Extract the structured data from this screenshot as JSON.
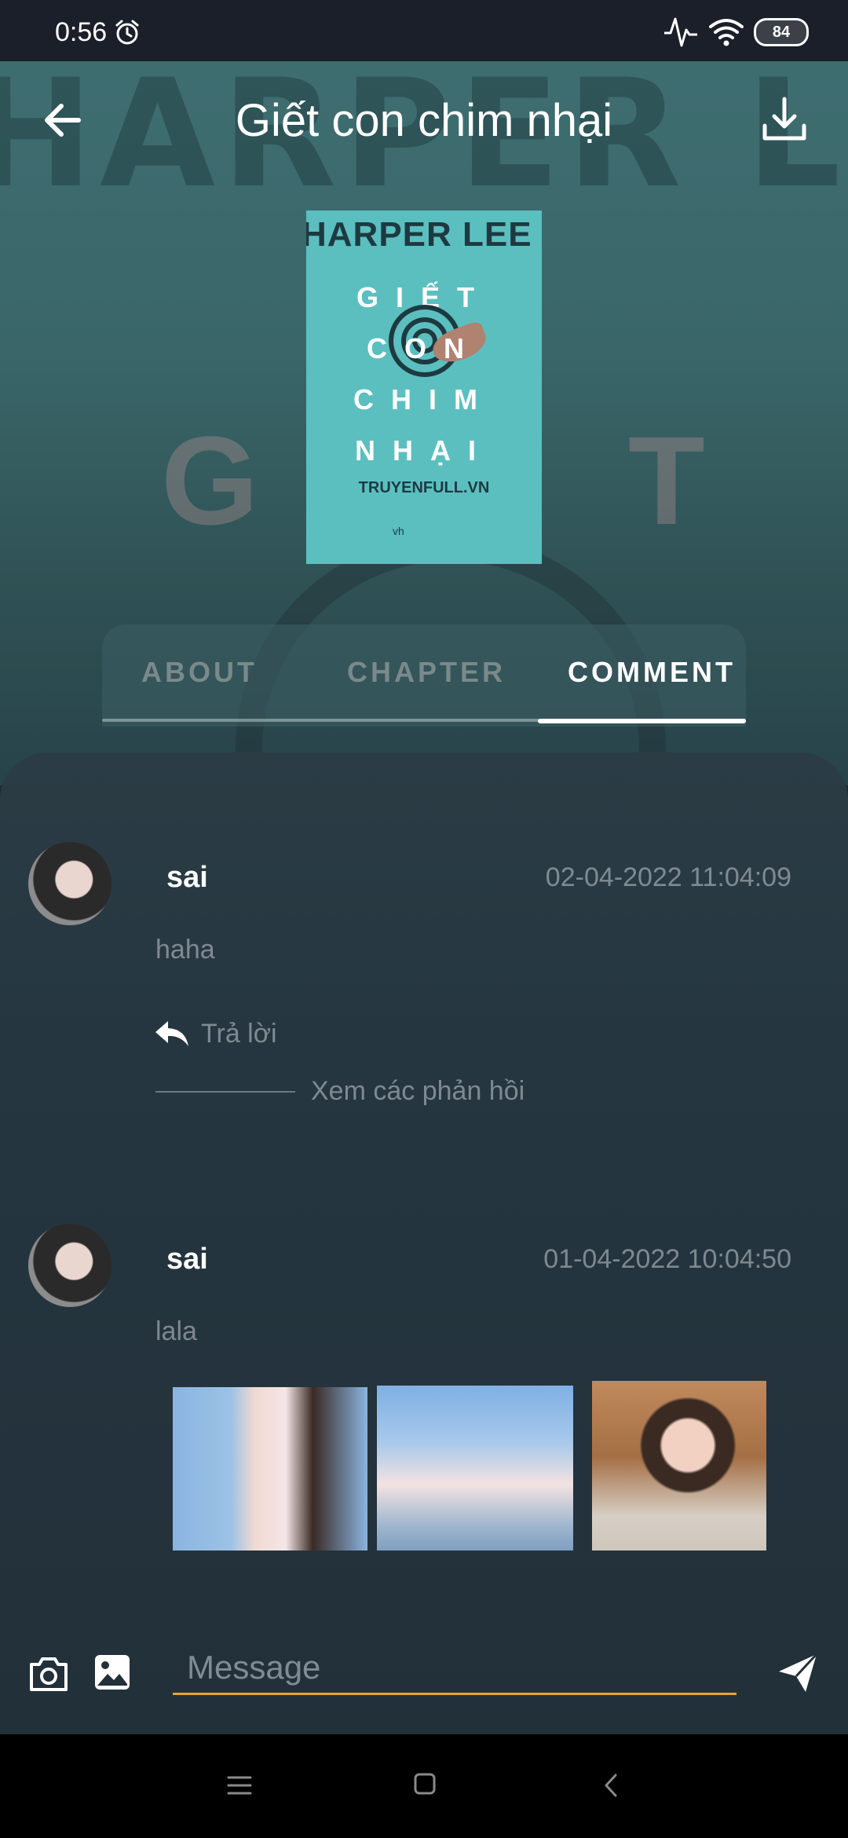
{
  "status_bar": {
    "time": "0:56",
    "battery": "84",
    "icons": [
      "alarm-icon",
      "activity-icon",
      "wifi-icon",
      "battery-icon"
    ]
  },
  "app_bar": {
    "title": "Giết con chim nhại",
    "back_icon": "arrow-left-icon",
    "download_icon": "download-icon"
  },
  "cover": {
    "author": "HARPER LEE",
    "title_lines": [
      "GIẾT",
      "CON",
      "CHIM",
      "NHẠI"
    ],
    "site": "TRUYENFULL.VN",
    "publisher": "vh"
  },
  "background_text": {
    "author": "HARPER LEE",
    "letter_left": "G",
    "letter_right": "T"
  },
  "tabs": [
    {
      "label": "ABOUT",
      "active": false
    },
    {
      "label": "CHAPTER",
      "active": false
    },
    {
      "label": "COMMENT",
      "active": true
    }
  ],
  "comments": [
    {
      "username": "sai",
      "timestamp": "02-04-2022 11:04:09",
      "text": "haha",
      "reply_label": "Trả lời",
      "view_replies_label": "Xem các phản hồi"
    },
    {
      "username": "sai",
      "timestamp": "01-04-2022 10:04:50",
      "text": "lala",
      "photos": [
        "photo-1",
        "photo-2",
        "photo-3"
      ]
    }
  ],
  "composer": {
    "placeholder": "Message",
    "accent_color": "#e7a42d"
  },
  "colors": {
    "status_bar": "#1b1f2a",
    "panel": "#253640",
    "cover": "#5bbfc0",
    "accent": "#e7a42d"
  }
}
